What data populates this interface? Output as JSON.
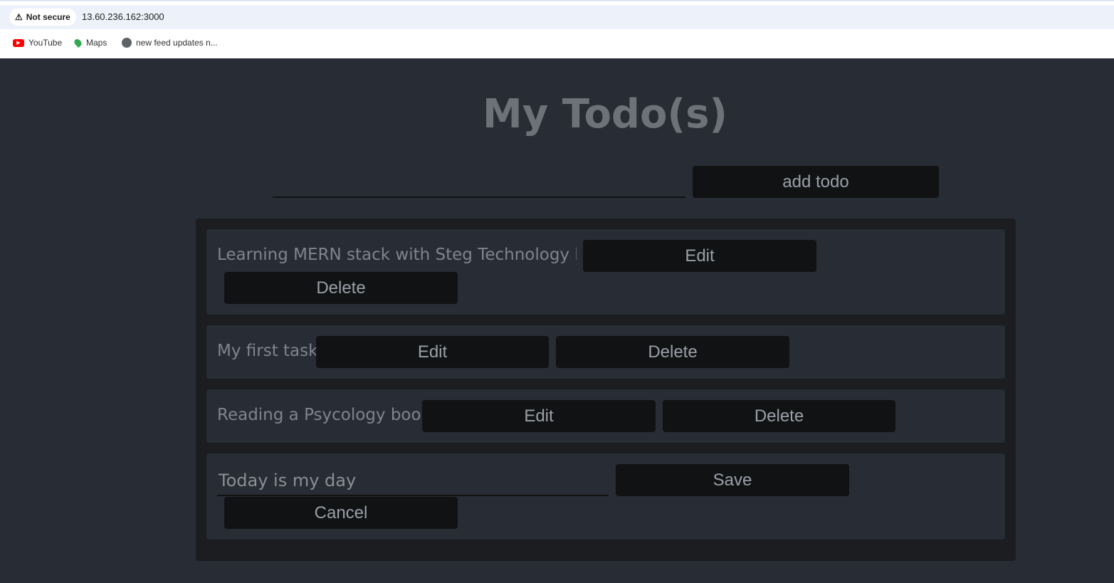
{
  "browser": {
    "security_label": "Not secure",
    "url": "13.60.236.162:3000",
    "bookmarks": [
      {
        "label": "YouTube",
        "icon": "youtube-icon"
      },
      {
        "label": "Maps",
        "icon": "maps-icon"
      },
      {
        "label": "new feed updates n...",
        "icon": "globe-icon"
      }
    ]
  },
  "app": {
    "title": "My Todo(s)",
    "new_todo_value": "",
    "add_label": "add todo",
    "todos": [
      {
        "text": "Learning MERN stack with Steg Technology hub",
        "edit": "Edit",
        "delete": "Delete"
      },
      {
        "text": "My first task",
        "edit": "Edit",
        "delete": "Delete"
      },
      {
        "text": "Reading a Psycology book",
        "edit": "Edit",
        "delete": "Delete"
      }
    ],
    "editing": {
      "value": "Today is my day",
      "save": "Save",
      "cancel": "Cancel"
    }
  },
  "colors": {
    "background": "#282c34",
    "container": "#1b1d21",
    "button": "#111214",
    "text": "#9aa0a6"
  }
}
